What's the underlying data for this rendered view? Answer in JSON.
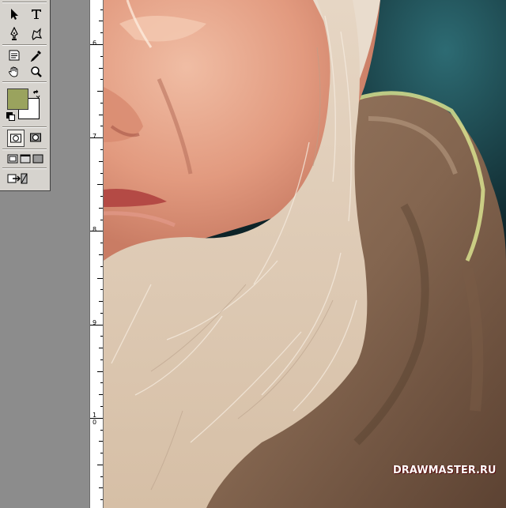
{
  "ruler": {
    "marks": [
      "6",
      "7",
      "8",
      "9",
      "1",
      "0"
    ]
  },
  "toolbox": {
    "foreground_color": "#9aa35e",
    "background_color": "#ffffff",
    "tools": [
      "path-selection-icon",
      "type-icon",
      "pen-icon",
      "custom-shape-icon",
      "notes-icon",
      "eyedropper-icon",
      "hand-icon",
      "zoom-icon",
      "standard-mode-icon",
      "quick-mask-icon",
      "screen-mode-standard-icon",
      "screen-mode-full-menu-icon",
      "screen-mode-full-icon",
      "jump-to-imageready-icon"
    ]
  },
  "watermark": {
    "text": "DRAWMASTER.RU"
  }
}
